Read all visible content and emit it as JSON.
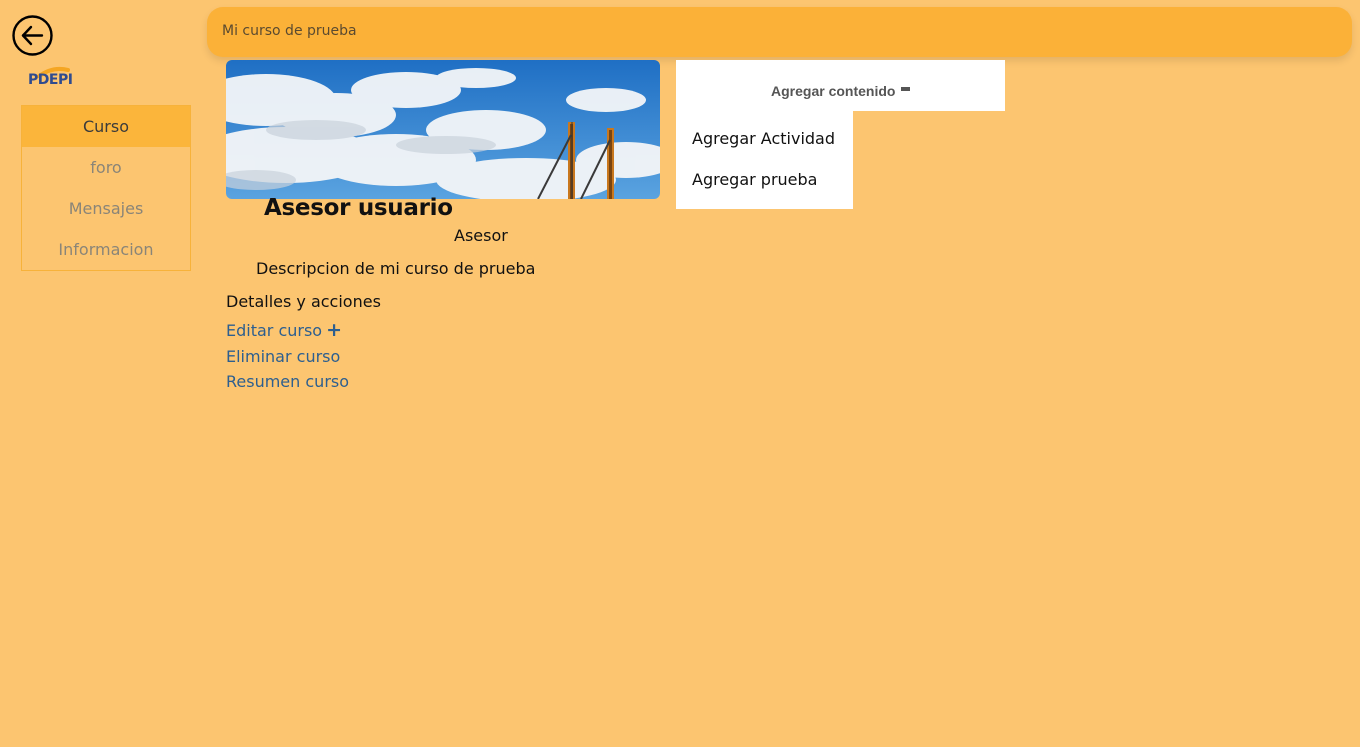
{
  "header": {
    "course_title": "Mi curso de prueba"
  },
  "logo": {
    "text": "PDEPI"
  },
  "icons": {
    "back": "arrow-left-circle-icon",
    "plus": "plus-icon",
    "minus": "minus-icon"
  },
  "sidebar": {
    "items": [
      {
        "label": "Curso",
        "active": true
      },
      {
        "label": "foro",
        "active": false
      },
      {
        "label": "Mensajes",
        "active": false
      },
      {
        "label": "Informacion",
        "active": false
      }
    ]
  },
  "course": {
    "user_name": "Asesor usuario",
    "role": "Asesor",
    "description": "Descripcion de mi curso de prueba"
  },
  "details": {
    "title": "Detalles y acciones",
    "actions": [
      "Editar curso",
      "Eliminar curso",
      "Resumen curso"
    ]
  },
  "content_menu": {
    "toggle_label": "Agregar contenido",
    "items": [
      "Agregar Actividad",
      "Agregar prueba"
    ]
  },
  "colors": {
    "background": "#fcc570",
    "topbar": "#fbb138",
    "sidebar_active": "#fbb53b",
    "link": "#2d5f8f"
  }
}
